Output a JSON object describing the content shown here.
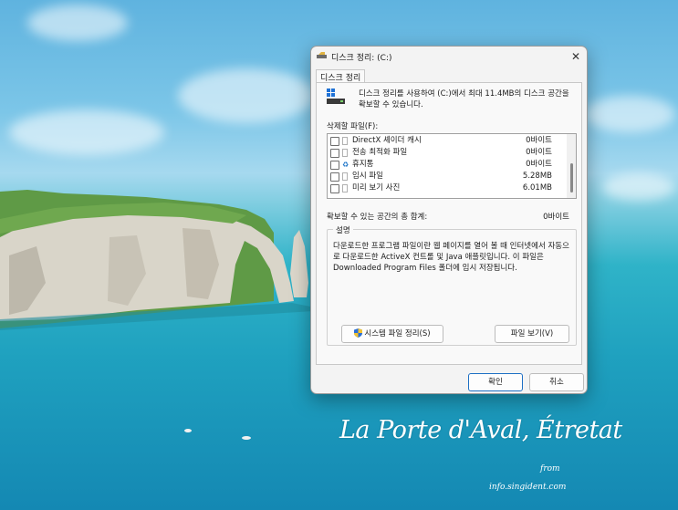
{
  "window": {
    "title": "디스크 정리: (C:)",
    "close_glyph": "✕"
  },
  "tabs": [
    {
      "label": "디스크 정리"
    }
  ],
  "intro_text": "디스크 정리를 사용하여 (C:)에서 최대 11.4MB의 디스크 공간을 확보할 수 있습니다.",
  "files": {
    "label": "삭제할 파일(F):",
    "rows": [
      {
        "name": "DirectX 셰이더 캐시",
        "size": "0바이트",
        "checked": false,
        "icon": "file-icon"
      },
      {
        "name": "전송 최적화 파일",
        "size": "0바이트",
        "checked": false,
        "icon": "file-icon"
      },
      {
        "name": "휴지통",
        "size": "0바이트",
        "checked": false,
        "icon": "recycle-bin-icon"
      },
      {
        "name": "임시 파일",
        "size": "5.28MB",
        "checked": false,
        "icon": "file-icon"
      },
      {
        "name": "미리 보기 사진",
        "size": "6.01MB",
        "checked": false,
        "icon": "file-icon"
      }
    ]
  },
  "total": {
    "label": "확보할 수 있는 공간의 총 합계:",
    "value": "0바이트"
  },
  "description": {
    "title": "설명",
    "text": "다운로드한 프로그램 파일이란 웹 페이지를 열어 볼 때 인터넷에서 자동으로 다운로드한 ActiveX 컨트롤 및 Java 애플릿입니다. 이 파일은 Downloaded Program Files 폴더에 임시 저장됩니다."
  },
  "buttons": {
    "system_cleanup": "시스템 파일 정리(S)",
    "view_files": "파일 보기(V)",
    "ok": "확인",
    "cancel": "취소"
  },
  "wallpaper": {
    "caption": "La Porte d'Aval, Étretat",
    "from": "from",
    "credit": "info.singident.com"
  },
  "colors": {
    "accent": "#1d6fc4",
    "dialog_bg": "#f3f3f3"
  }
}
